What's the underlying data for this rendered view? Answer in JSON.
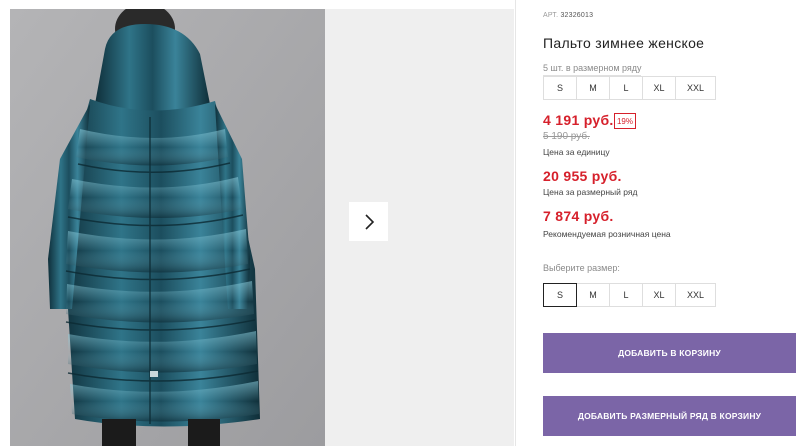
{
  "gallery": {
    "photo_alt": "Пальто зимнее женское",
    "next_icon": "chevron-right-icon"
  },
  "product": {
    "article_label": "АРТ.",
    "article_value": "32326013",
    "title": "Пальто зимнее женское",
    "pack_text": "5 шт. в размерном ряду",
    "pack_sizes": [
      "S",
      "M",
      "L",
      "XL",
      "XXL"
    ],
    "price_unit": "4 191 руб.",
    "discount_badge": "19%",
    "old_price": "5 190 руб.",
    "price_unit_caption": "Цена за единицу",
    "price_pack": "20 955 руб.",
    "price_pack_caption": "Цена за размерный ряд",
    "price_retail": "7 874 руб.",
    "price_retail_caption": "Рекомендуемая розничная цена",
    "choose_size_label": "Выберите размер:",
    "select_sizes": [
      "S",
      "M",
      "L",
      "XL",
      "XXL"
    ],
    "selected_size": "S",
    "add_to_cart": "ДОБАВИТЬ В КОРЗИНУ",
    "add_pack_to_cart": "ДОБАВИТЬ РАЗМЕРНЫЙ РЯД В КОРЗИНУ"
  },
  "colors": {
    "accent_purple": "#7b65a7",
    "price_red": "#d6202b",
    "coat_teal": "#1f5566"
  }
}
